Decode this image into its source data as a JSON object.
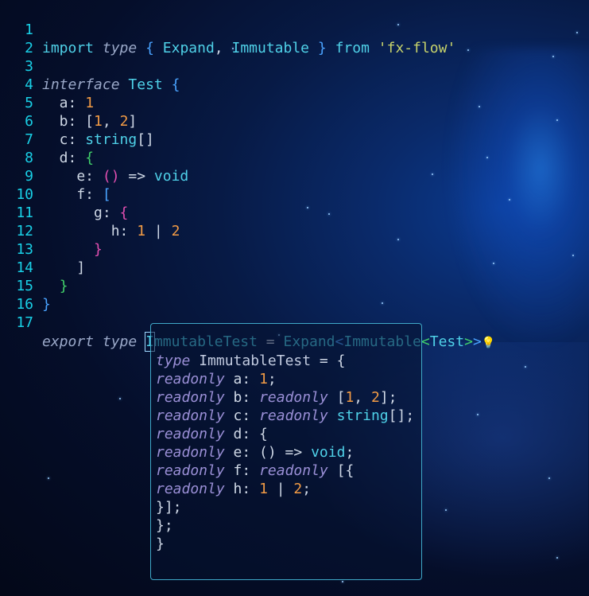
{
  "editor": {
    "lines": [
      {
        "n": "1"
      },
      {
        "n": "2"
      },
      {
        "n": "3"
      },
      {
        "n": "4"
      },
      {
        "n": "5"
      },
      {
        "n": "6"
      },
      {
        "n": "7"
      },
      {
        "n": "8"
      },
      {
        "n": "9"
      },
      {
        "n": "10"
      },
      {
        "n": "11"
      },
      {
        "n": "12"
      },
      {
        "n": "13"
      },
      {
        "n": "14"
      },
      {
        "n": "15"
      },
      {
        "n": "16"
      },
      {
        "n": "17"
      }
    ],
    "import_module": "'fx-flow'",
    "type_names": {
      "expand": "Expand",
      "immutable": "Immutable",
      "test": "Test",
      "immutable_test": "ImmutableTest"
    }
  },
  "hover": {
    "title": "type ImmutableTest = {",
    "type_keyword": "type",
    "type_name": "ImmutableTest"
  },
  "colors": {
    "line_number": "#19d0e6",
    "keyword": "#4fd1e8",
    "number": "#f29b45",
    "string": "#c7d36b",
    "bracket_pink": "#e34fb1",
    "bracket_green": "#41d16a",
    "bracket_blue": "#4aa3ff"
  }
}
